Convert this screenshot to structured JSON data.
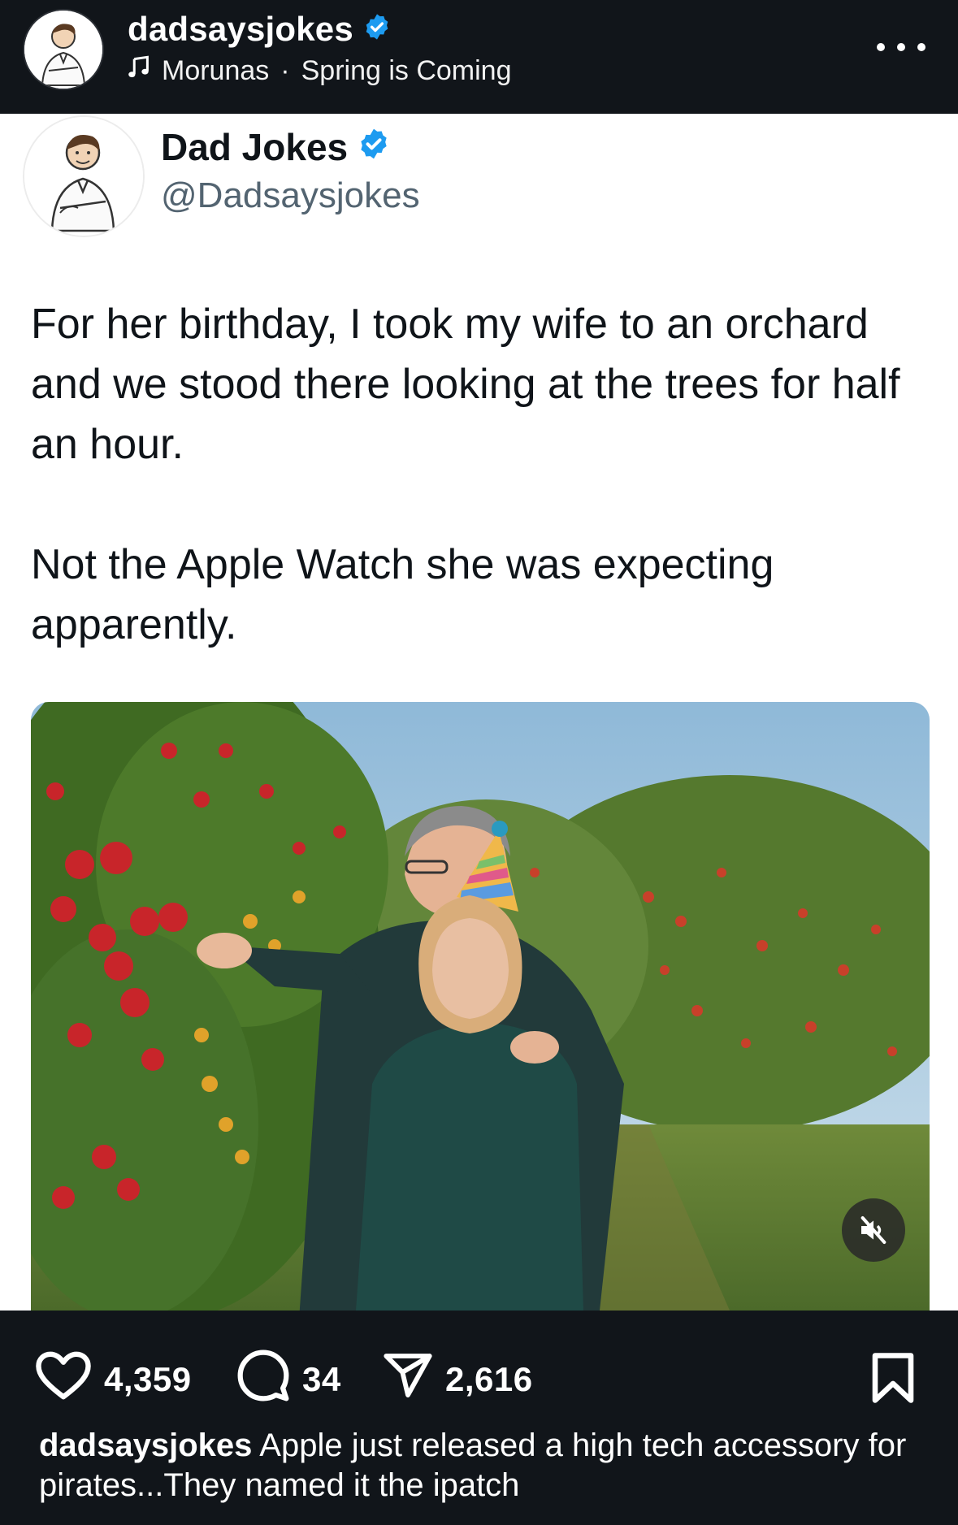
{
  "header": {
    "username": "dadsaysjokes",
    "audio_artist": "Morunas",
    "audio_separator": "·",
    "audio_track": "Spring is Coming"
  },
  "tweet": {
    "name": "Dad Jokes",
    "handle": "@Dadsaysjokes",
    "paragraph_1": "For her birthday, I took my wife to an orchard and we stood there looking at the trees for half an hour.",
    "paragraph_2": "Not the Apple Watch she was expecting apparently."
  },
  "actions": {
    "likes": "4,359",
    "comments": "34",
    "shares": "2,616"
  },
  "caption": {
    "username": "dadsaysjokes",
    "text": "Apple just released a high tech accessory for  pirates...They named it the ipatch"
  },
  "icons": {
    "verified": "verified-badge-icon",
    "music": "music-note-icon",
    "more": "more-options-icon",
    "like": "heart-icon",
    "comment": "comment-bubble-icon",
    "share": "paper-plane-icon",
    "bookmark": "bookmark-icon",
    "mute": "muted-speaker-icon"
  },
  "colors": {
    "verified_blue": "#1d9bf0",
    "dark_bg": "#11151a",
    "handle_gray": "#536471"
  }
}
